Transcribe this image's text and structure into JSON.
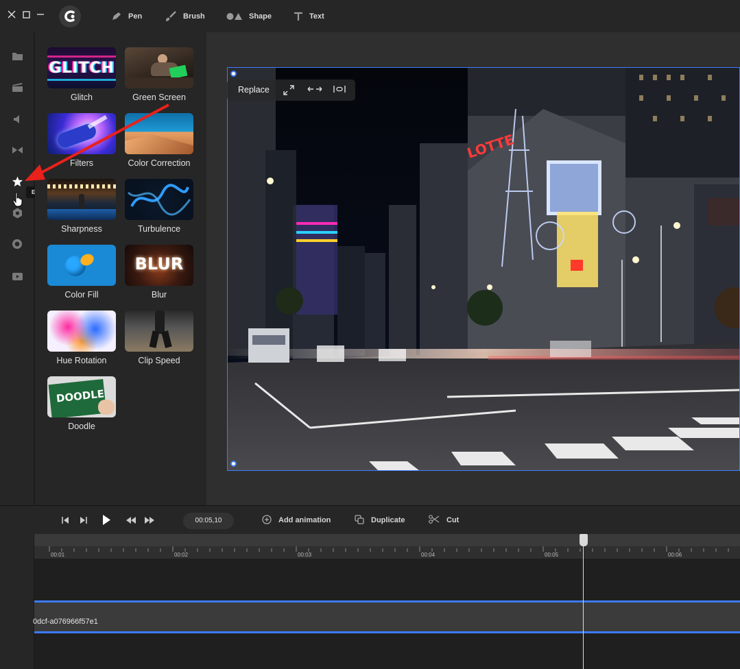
{
  "toolbar": {
    "tools": [
      {
        "label": "Pen",
        "icon": "pen-icon"
      },
      {
        "label": "Brush",
        "icon": "brush-icon"
      },
      {
        "label": "Shape",
        "icon": "shape-icon"
      },
      {
        "label": "Text",
        "icon": "text-icon"
      }
    ]
  },
  "sidebar": {
    "icons": [
      "folder-icon",
      "clapperboard-icon",
      "speaker-icon",
      "transition-icon",
      "star-icon",
      "sticker-icon",
      "record-icon",
      "video-icon"
    ],
    "tooltip": "EFFECTS"
  },
  "effects": [
    {
      "label": "Glitch",
      "thumb_text": "GLITCH"
    },
    {
      "label": "Green Screen",
      "thumb_text": ""
    },
    {
      "label": "Filters",
      "thumb_text": ""
    },
    {
      "label": "Color Correction",
      "thumb_text": ""
    },
    {
      "label": "Sharpness",
      "thumb_text": ""
    },
    {
      "label": "Turbulence",
      "thumb_text": ""
    },
    {
      "label": "Color Fill",
      "thumb_text": ""
    },
    {
      "label": "Blur",
      "thumb_text": "BLUR"
    },
    {
      "label": "Hue Rotation",
      "thumb_text": ""
    },
    {
      "label": "Clip Speed",
      "thumb_text": ""
    },
    {
      "label": "Doodle",
      "thumb_text": "DOODLE"
    }
  ],
  "preview": {
    "toolbar": {
      "replace_label": "Replace"
    },
    "sign_text": "LOTTE"
  },
  "timeline": {
    "timecode": "00:05,10",
    "actions": [
      {
        "label": "Add animation",
        "icon": "add-circle-icon"
      },
      {
        "label": "Duplicate",
        "icon": "duplicate-icon"
      },
      {
        "label": "Cut",
        "icon": "scissors-icon"
      }
    ],
    "ticks": [
      "00:01",
      "00:02",
      "00:03",
      "00:04",
      "00:05",
      "00:06"
    ],
    "clip_label": "0dcf-a076966f57e1"
  },
  "colors": {
    "accent": "#3d7bff",
    "annotation_arrow": "#e8211b"
  }
}
